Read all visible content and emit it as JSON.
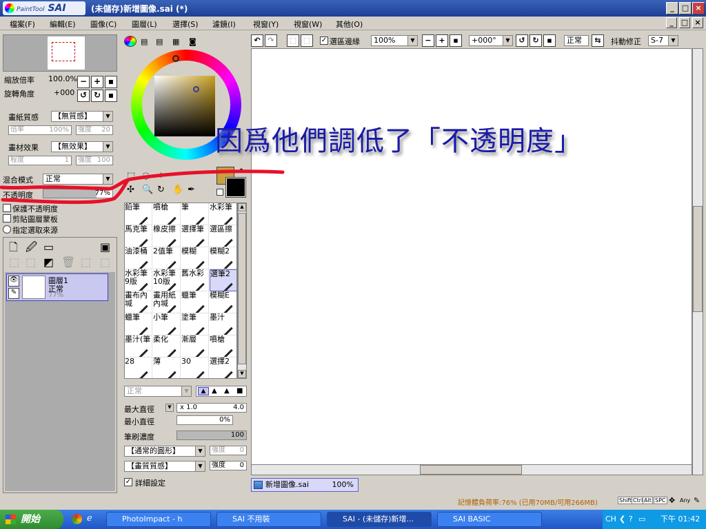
{
  "window": {
    "logo_text": "PaintTool",
    "logo_sai": "SAI",
    "title": "(未儲存)新增圖像.sai (*)"
  },
  "menu": [
    "檔案(F)",
    "編輯(E)",
    "圖像(C)",
    "圖層(L)",
    "選擇(S)",
    "濾鏡(I)",
    "視窗(Y)",
    "視窗(W)",
    "其他(O)"
  ],
  "navigator": {
    "zoom_label": "縮放倍率",
    "zoom_value": "100.0%",
    "angle_label": "旋轉角度",
    "angle_value": "+000"
  },
  "paper": {
    "texture_label": "畫紙質感",
    "texture_value": "【無質感】",
    "scale_label": "倍率",
    "scale_value": "100%",
    "strength_label": "強度",
    "strength_value": "20"
  },
  "effect": {
    "label": "畫材效果",
    "value": "【無效果】",
    "level_label": "程度",
    "level_value": "1",
    "strength_label": "強度",
    "strength_value": "100"
  },
  "blend": {
    "mode_label": "混合模式",
    "mode_value": "正常",
    "opacity_label": "不透明度",
    "opacity_value": "77%",
    "opacity_fraction": 0.77
  },
  "options": {
    "preserve": "保護不透明度",
    "clip": "剪貼圖層蒙板",
    "source": "指定選取來源"
  },
  "layer": {
    "name": "圖層1",
    "mode": "正常",
    "opacity": "77%"
  },
  "brushes": [
    [
      "鉛筆",
      "噴槍",
      "筆",
      "水彩筆"
    ],
    [
      "馬克筆",
      "橡皮擦",
      "選擇筆",
      "選區擦"
    ],
    [
      "油漆桶",
      "2值筆",
      "模糊",
      "模糊2"
    ],
    [
      "水彩筆9版",
      "水彩筆10版",
      "舊水彩",
      "選筆2"
    ],
    [
      "畫布內堿",
      "畫用紙內堿",
      "蠟筆",
      "模糊E"
    ],
    [
      "蠟筆",
      "小筆",
      "塗筆",
      "墨汁"
    ],
    [
      "墨汁(筆",
      "柔化",
      "漸層",
      "噴槍"
    ],
    [
      "28",
      "薄",
      "30",
      "選擇2"
    ]
  ],
  "brush_settings": {
    "mode": "正常",
    "max_label": "最大直徑",
    "max_mult": "x 1.0",
    "max_value": "4.0",
    "min_label": "最小直徑",
    "min_value": "0%",
    "density_label": "筆刷濃度",
    "density_value": "100",
    "shape": "【通常的圓形】",
    "shape_strength_label": "強度",
    "shape_strength_value": "0",
    "texture": "【畫質質感】",
    "texture_strength_label": "強度",
    "texture_strength_value": "0",
    "detail": "詳細設定"
  },
  "canvas_toolbar": {
    "selection_edge": "選區邊緣",
    "zoom": "100%",
    "angle": "+000°",
    "mode": "正常",
    "stabilizer_label": "抖動修正",
    "stabilizer_value": "S-7"
  },
  "caption": "因爲他們調低了「不透明度」",
  "doc_tab": {
    "name": "新增圖像.sai",
    "zoom": "100%"
  },
  "status": {
    "memory": "記憶體負荷率:76% (已用70MB/可用266MB)",
    "keys": [
      "Shift",
      "Ctrl",
      "Alt",
      "SPC"
    ],
    "any": "Any"
  },
  "taskbar": {
    "start": "開始",
    "tasks": [
      "PhotoImpact - h",
      "SAI 不用裝",
      "SAI - (未儲存)新增...",
      "SAI BASIC"
    ],
    "lang": "CH",
    "clock": "下午 01:42"
  },
  "colors": {
    "accent": "#1c3f94",
    "caption": "#1a1aa8",
    "annotation": "#e8102a",
    "fg_color": "#c8a040"
  }
}
